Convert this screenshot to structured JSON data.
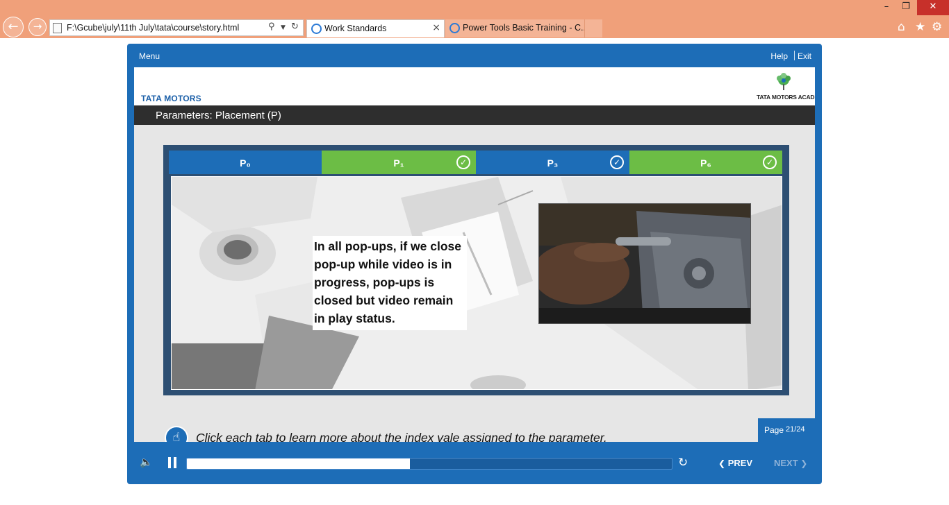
{
  "browser": {
    "address": "F:\\Gcube\\july\\11th July\\tata\\course\\story.html",
    "tabs": [
      {
        "label": "Work Standards"
      },
      {
        "label": "Power Tools Basic Training - C..."
      }
    ],
    "close_symbol": "×"
  },
  "player": {
    "menu_label": "Menu",
    "help_label": "Help",
    "exit_label": "Exit",
    "brand_left": "TATA MOTORS",
    "brand_right": "TATA MOTORS ACADEMY",
    "title": "Parameters: Placement (P)",
    "tabs": [
      {
        "label": "P₀",
        "completed": false,
        "color": "#1d6db7"
      },
      {
        "label": "P₁",
        "completed": true,
        "color": "#6cbd45"
      },
      {
        "label": "P₃",
        "completed": true,
        "color": "#1d6db7"
      },
      {
        "label": "P₆",
        "completed": true,
        "color": "#6cbd45"
      }
    ],
    "popup_text": "In all pop-ups, if we close pop-up while video is in progress, pop-ups is closed but video remain in play status.",
    "instruction": "Click each tab to learn more about the index vale assigned to the parameter.",
    "page": {
      "word": "Page",
      "count": "21/24"
    },
    "progress_fraction": 0.46,
    "prev_label": "PREV",
    "next_label": "NEXT",
    "icons": {
      "check": "check-icon",
      "hint": "hand-pointer-icon",
      "volume": "speaker-icon",
      "pause": "pause-icon",
      "replay": "replay-icon"
    },
    "colors": {
      "frame_blue": "#1d6db7",
      "tab_green": "#6cbd45",
      "title_bar": "#2e2e2e"
    }
  }
}
